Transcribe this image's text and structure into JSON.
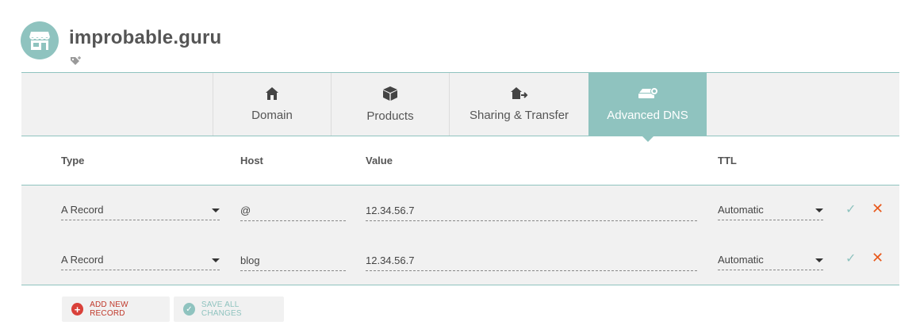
{
  "domain": {
    "name": "improbable.guru"
  },
  "tabs": [
    {
      "label": "Domain",
      "icon": "home-icon",
      "active": false
    },
    {
      "label": "Products",
      "icon": "box-icon",
      "active": false
    },
    {
      "label": "Sharing & Transfer",
      "icon": "home-transfer-icon",
      "active": false
    },
    {
      "label": "Advanced DNS",
      "icon": "server-icon",
      "active": true
    }
  ],
  "table": {
    "headers": {
      "type": "Type",
      "host": "Host",
      "value": "Value",
      "ttl": "TTL"
    },
    "rows": [
      {
        "type": "A Record",
        "host": "@",
        "value": "12.34.56.7",
        "ttl": "Automatic"
      },
      {
        "type": "A Record",
        "host": "blog",
        "value": "12.34.56.7",
        "ttl": "Automatic"
      }
    ]
  },
  "actions": {
    "add_record": "ADD NEW RECORD",
    "save_all": "SAVE ALL CHANGES"
  },
  "colors": {
    "accent": "#8fc3bf",
    "danger": "#e8591c",
    "add": "#d9413a",
    "panel": "#f1f1f1"
  }
}
